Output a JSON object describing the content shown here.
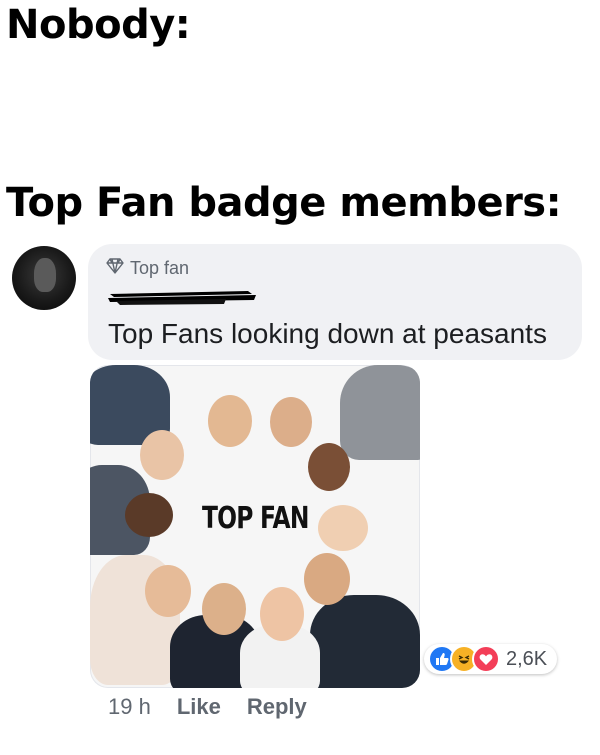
{
  "meme": {
    "caption_top": "Nobody:",
    "caption_middle": "Top Fan badge members:"
  },
  "comment": {
    "badge_label": "Top fan",
    "badge_icon": "diamond-icon",
    "text": "Top Fans looking down at peasants",
    "image_label": "TOP FAN",
    "reactions": {
      "icons": [
        "like-icon",
        "haha-icon",
        "love-icon"
      ],
      "count": "2,6K"
    },
    "actions": {
      "timestamp": "19 h",
      "like_label": "Like",
      "reply_label": "Reply"
    }
  },
  "colors": {
    "bubble_bg": "#f0f1f4",
    "like_blue": "#2078f4",
    "haha_yellow": "#f7b125",
    "love_red": "#f33e58",
    "meta_grey": "#606770"
  }
}
